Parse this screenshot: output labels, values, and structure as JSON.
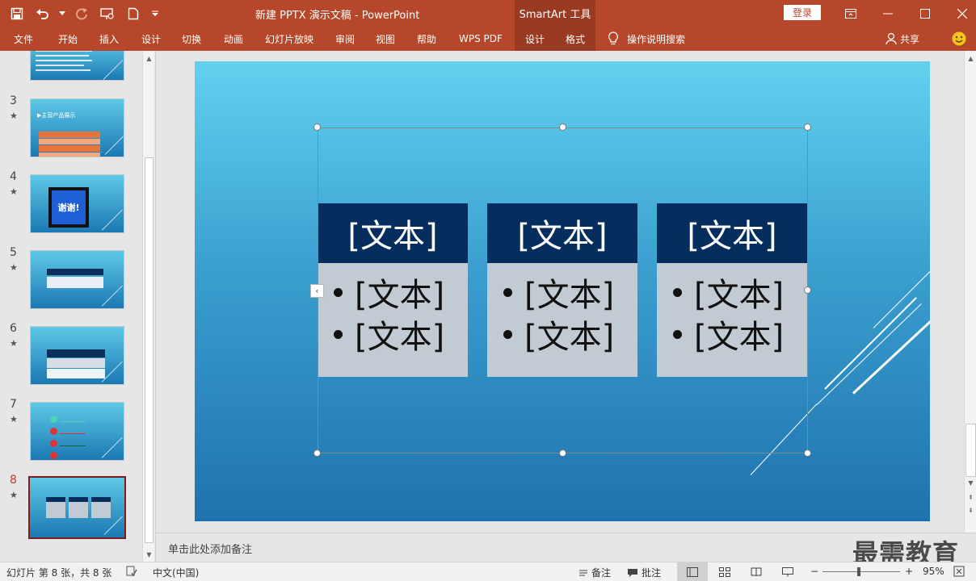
{
  "titlebar": {
    "doc_title": "新建 PPTX 演示文稿  -  PowerPoint",
    "context_tab": "SmartArt 工具",
    "login": "登录"
  },
  "ribbon": {
    "tabs": [
      "文件",
      "开始",
      "插入",
      "设计",
      "切换",
      "动画",
      "幻灯片放映",
      "审阅",
      "视图",
      "帮助",
      "WPS PDF"
    ],
    "context_tabs": [
      "设计",
      "格式"
    ],
    "tell_me": "操作说明搜索",
    "share": "共享"
  },
  "thumbnails": [
    {
      "num": "3",
      "star": "★"
    },
    {
      "num": "4",
      "star": "★"
    },
    {
      "num": "5",
      "star": "★"
    },
    {
      "num": "6",
      "star": "★"
    },
    {
      "num": "7",
      "star": "★"
    },
    {
      "num": "8",
      "star": "★"
    }
  ],
  "thumb_text": {
    "slide3_title": "▶主营产品展示",
    "slide4_text": "谢谢!"
  },
  "slide": {
    "cards": [
      {
        "title": "[文本]",
        "bullets": [
          "[文本]",
          "[文本]"
        ]
      },
      {
        "title": "[文本]",
        "bullets": [
          "[文本]",
          "[文本]"
        ]
      },
      {
        "title": "[文本]",
        "bullets": [
          "[文本]",
          "[文本]"
        ]
      }
    ],
    "toggle": "‹"
  },
  "notes": {
    "placeholder": "单击此处添加备注",
    "watermark": "最需教育"
  },
  "status": {
    "slide_info": "幻灯片 第 8 张，共 8 张",
    "language": "中文(中国)",
    "notes_btn": "备注",
    "comments_btn": "批注",
    "zoom": "95%",
    "minus": "−",
    "plus": "+"
  },
  "colors": {
    "accent": "#b7472a",
    "card_header": "#052e5e",
    "card_body": "#c2cbd3"
  }
}
